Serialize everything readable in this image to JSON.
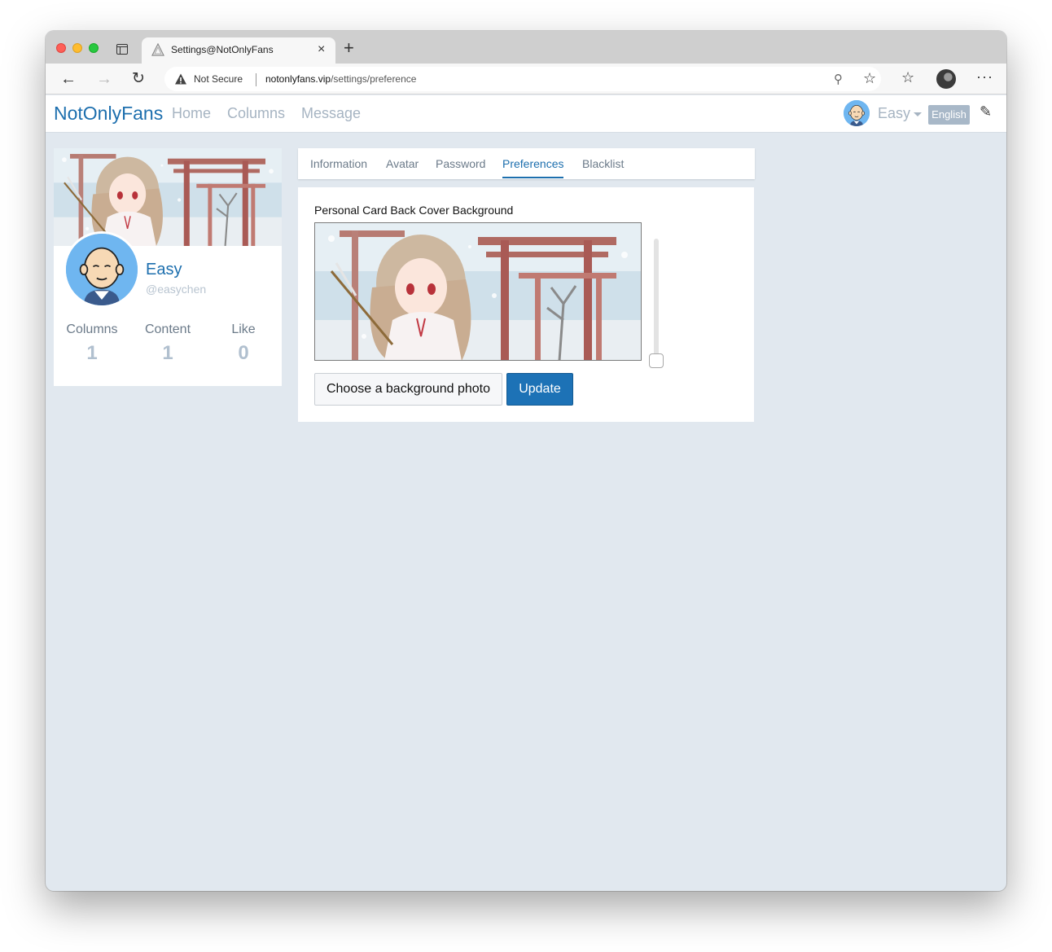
{
  "browser": {
    "tab_title": "Settings@NotOnlyFans",
    "tab_close": "×",
    "new_tab": "+",
    "security_label": "Not Secure",
    "url_host": "notonlyfans.vip",
    "url_path": "/settings/preference",
    "icons": [
      "back-arrow-icon",
      "forward-arrow-icon",
      "reload-icon",
      "warning-icon",
      "key-icon",
      "add-favorite-icon",
      "favorites-icon",
      "profile-icon",
      "more-icon"
    ]
  },
  "navbar": {
    "brand": "NotOnlyFans",
    "links": [
      "Home",
      "Columns",
      "Message"
    ],
    "username": "Easy",
    "language": "English",
    "link_color": "#a6b4c2",
    "brand_color": "#1d6fae"
  },
  "profile": {
    "name": "Easy",
    "handle": "@easychen",
    "stats": [
      {
        "label": "Columns",
        "value": "1"
      },
      {
        "label": "Content",
        "value": "1"
      },
      {
        "label": "Like",
        "value": "0"
      }
    ]
  },
  "settings": {
    "tabs": [
      "Information",
      "Avatar",
      "Password",
      "Preferences",
      "Blacklist"
    ],
    "active_tab": "Preferences",
    "section_label": "Personal Card Back Cover Background",
    "choose_button": "Choose a background photo",
    "update_button": "Update",
    "accent_color": "#1d72b6"
  }
}
